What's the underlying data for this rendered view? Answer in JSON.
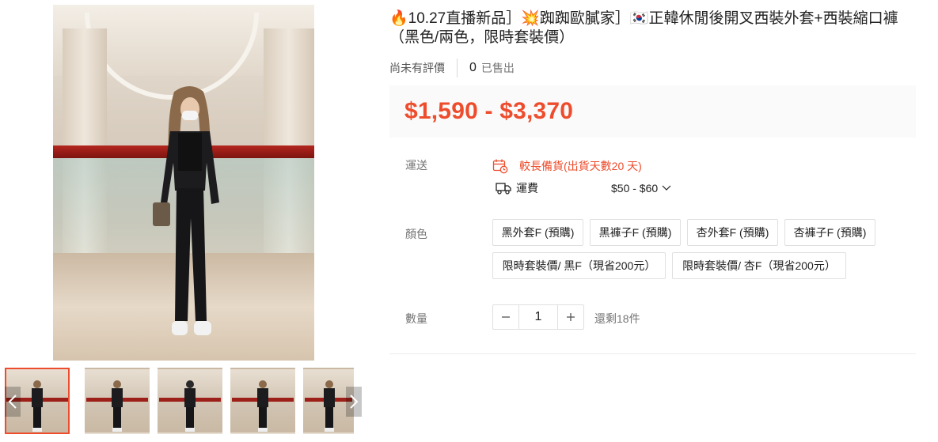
{
  "product": {
    "title": "🔥10.27直播新品］💥踟踟歐膩家］🇰🇷正韓休閒後開叉西裝外套+西裝縮口褲（黑色/兩色，限時套裝價）",
    "rating_text": "尚未有評價",
    "sold_count": "0",
    "sold_label": "已售出",
    "price": "$1,590 - $3,370"
  },
  "shipping": {
    "label": "運送",
    "preorder_text": "較長備貨(出貨天數20 天)",
    "fee_label": "運費",
    "fee_range": "$50 - $60"
  },
  "color": {
    "label": "顏色",
    "options": [
      "黑外套F (預購)",
      "黑褲子F (預購)",
      "杏外套F (預購)",
      "杏褲子F (預購)",
      "限時套裝價/ 黑F（現省200元）",
      "限時套裝價/ 杏F（現省200元）"
    ]
  },
  "quantity": {
    "label": "數量",
    "value": "1",
    "stock_text": "還剩18件"
  },
  "colors": {
    "accent": "#ee4d2d",
    "price_bg": "#fafafa"
  },
  "icons": {
    "prev": "chevron-left-icon",
    "next": "chevron-right-icon",
    "preorder": "calendar-clock-icon",
    "truck": "truck-icon",
    "dropdown": "chevron-down-icon",
    "minus": "minus-icon",
    "plus": "plus-icon"
  }
}
